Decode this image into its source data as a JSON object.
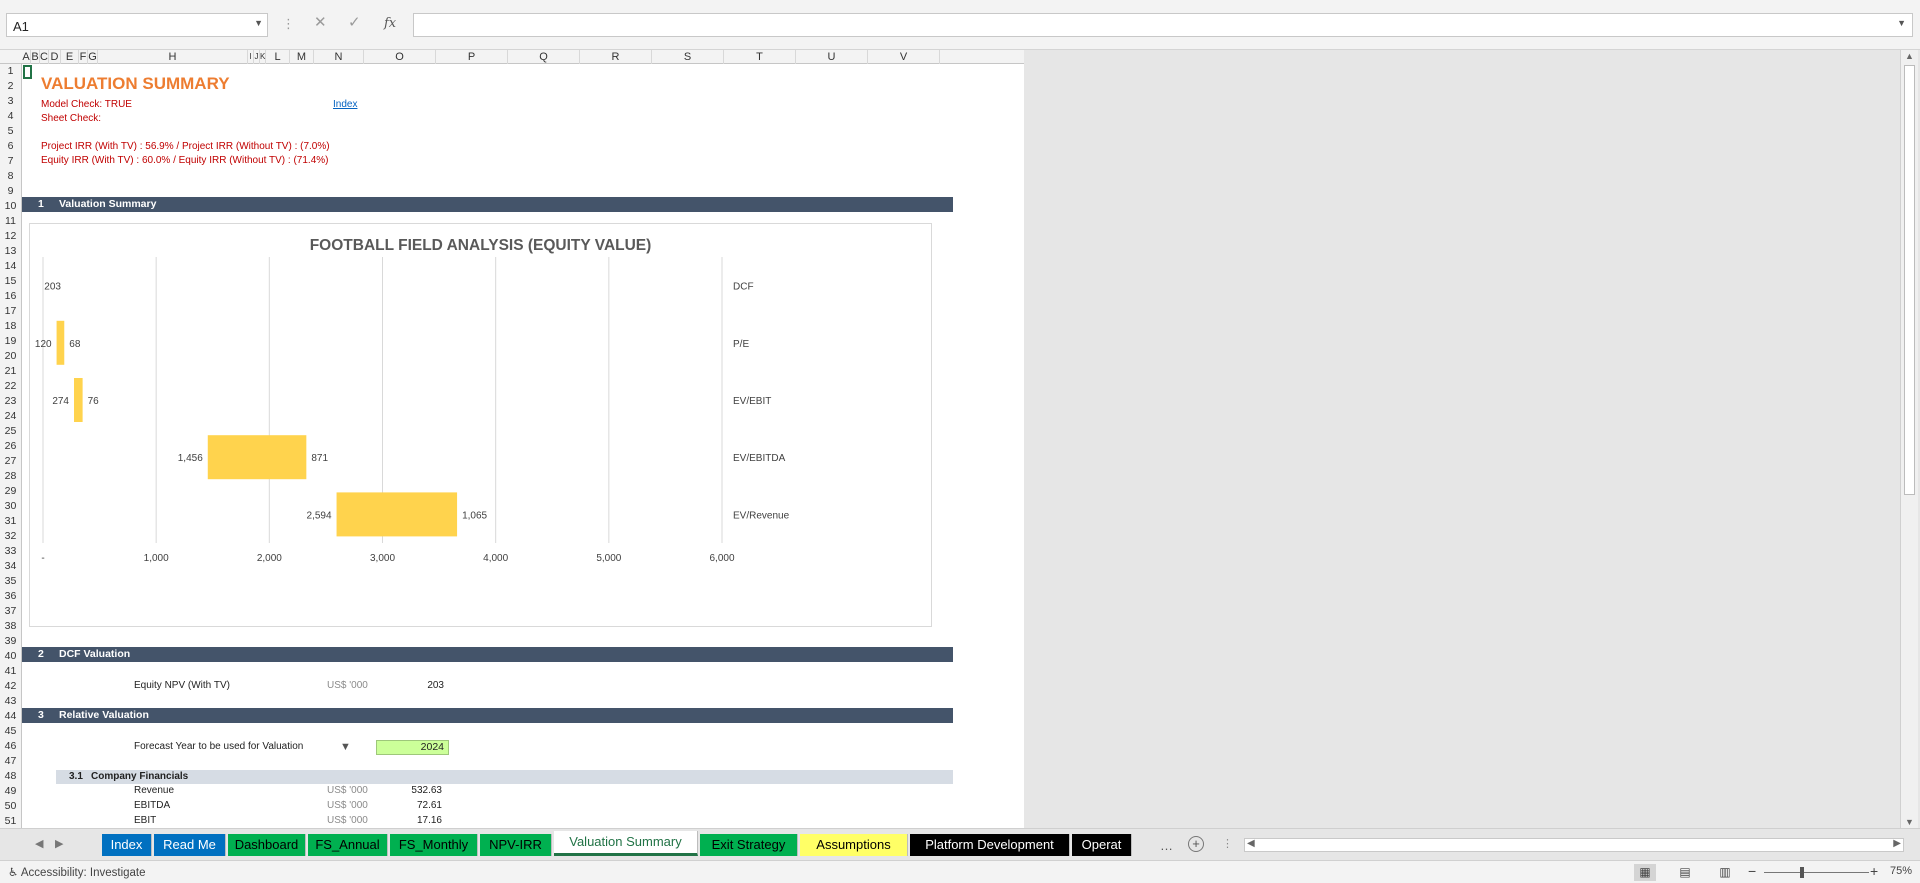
{
  "formula_bar": {
    "namebox": "A1",
    "formula": "",
    "cancel_icon": "✕",
    "enter_icon": "✓",
    "fx_label": "fx"
  },
  "columns": [
    "A",
    "B",
    "C",
    "D",
    "E",
    "F",
    "G",
    "H",
    "I",
    "J",
    "K",
    "L",
    "M",
    "N",
    "O",
    "P",
    "Q",
    "R",
    "S",
    "T",
    "U",
    "V"
  ],
  "rows": [
    "1",
    "2",
    "3",
    "4",
    "5",
    "6",
    "7",
    "8",
    "9",
    "10",
    "11",
    "12",
    "13",
    "14",
    "15",
    "16",
    "17",
    "18",
    "19",
    "20",
    "21",
    "22",
    "23",
    "24",
    "25",
    "26",
    "27",
    "28",
    "29",
    "30",
    "31",
    "32",
    "33",
    "34",
    "35",
    "36",
    "37",
    "38",
    "39",
    "40",
    "41",
    "42",
    "43",
    "44",
    "45",
    "46",
    "47",
    "48",
    "49",
    "50",
    "51"
  ],
  "sheet": {
    "title": "VALUATION SUMMARY",
    "model_check": "Model Check: TRUE",
    "sheet_check": "Sheet Check:",
    "index_link": "Index",
    "project_irr": "Project IRR  (With TV) : 56.9%  / Project IRR (Without TV) : (7.0%)",
    "equity_irr": "Equity IRR  (With TV) : 60.0%  / Equity IRR (Without TV) : (71.4%)",
    "sections": [
      {
        "num": "1",
        "label": "Valuation Summary"
      },
      {
        "num": "2",
        "label": "DCF Valuation"
      },
      {
        "num": "3",
        "label": "Relative Valuation"
      }
    ],
    "dcf": {
      "label": "Equity NPV (With TV)",
      "unit": "US$ '000",
      "value": "203"
    },
    "relative": {
      "forecast_label": "Forecast Year to be used for Valuation",
      "forecast_value": "2024",
      "sub_num": "3.1",
      "sub_label": "Company Financials",
      "rows": [
        {
          "label": "Revenue",
          "unit": "US$ '000",
          "value": "532.63"
        },
        {
          "label": "EBITDA",
          "unit": "US$ '000",
          "value": "72.61"
        },
        {
          "label": "EBIT",
          "unit": "US$ '000",
          "value": "17.16"
        }
      ]
    }
  },
  "chart_data": {
    "type": "bar",
    "orientation": "horizontal-floating",
    "title": "FOOTBALL FIELD ANALYSIS (EQUITY VALUE)",
    "xlabel": "",
    "ylabel": "",
    "xlim": [
      0,
      6000
    ],
    "x_ticks": [
      "-",
      "1,000",
      "2,000",
      "3,000",
      "4,000",
      "5,000",
      "6,000"
    ],
    "x_tick_values": [
      0,
      1000,
      2000,
      3000,
      4000,
      5000,
      6000
    ],
    "grid": true,
    "bar_color": "#ffd34d",
    "categories": [
      "DCF",
      "P/E",
      "EV/EBIT",
      "EV/EBITDA",
      "EV/Revenue"
    ],
    "low": [
      203,
      120,
      274,
      1456,
      2594
    ],
    "spread": [
      0,
      68,
      76,
      871,
      1065
    ],
    "low_labels": [
      "203",
      "120",
      "274",
      "1,456",
      "2,594"
    ],
    "spread_labels": [
      "",
      "68",
      "76",
      "871",
      "1,065"
    ]
  },
  "tabs": [
    {
      "label": "Index",
      "bg": "#0070c0",
      "fg": "#ffffff"
    },
    {
      "label": "Read Me",
      "bg": "#0070c0",
      "fg": "#ffffff"
    },
    {
      "label": "Dashboard",
      "bg": "#00b050",
      "fg": "#000000"
    },
    {
      "label": "FS_Annual",
      "bg": "#00b050",
      "fg": "#000000"
    },
    {
      "label": "FS_Monthly",
      "bg": "#00b050",
      "fg": "#000000"
    },
    {
      "label": "NPV-IRR",
      "bg": "#00b050",
      "fg": "#000000"
    },
    {
      "label": "Valuation Summary",
      "bg": "#ffffff",
      "fg": "#217346",
      "active": true
    },
    {
      "label": "Exit Strategy",
      "bg": "#00b050",
      "fg": "#000000"
    },
    {
      "label": "Assumptions",
      "bg": "#ffff66",
      "fg": "#000000"
    },
    {
      "label": "Platform Development",
      "bg": "#000000",
      "fg": "#ffffff"
    },
    {
      "label": "Operat",
      "bg": "#000000",
      "fg": "#ffffff"
    }
  ],
  "statusbar": {
    "accessibility": "Accessibility: Investigate",
    "zoom": "75%"
  }
}
